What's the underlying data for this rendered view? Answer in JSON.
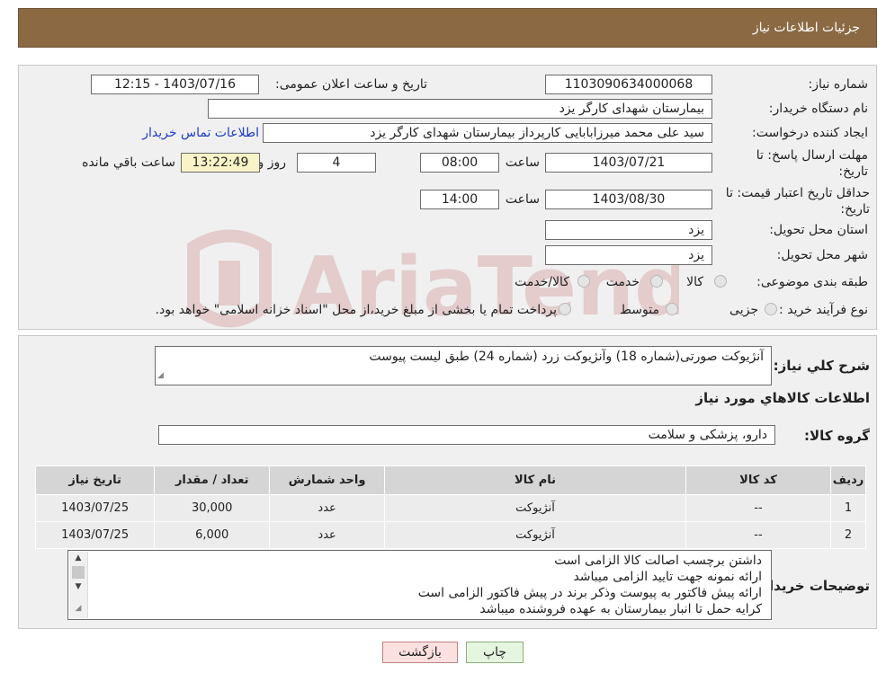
{
  "header": {
    "title": "جزئیات اطلاعات نیاز"
  },
  "form": {
    "need_number_label": "شماره نیاز:",
    "need_number": "1103090634000068",
    "announce_label": "تاریخ و ساعت اعلان عمومی:",
    "announce_value": "1403/07/16 - 12:15",
    "buyer_org_label": "نام دستگاه خریدار:",
    "buyer_org": "بیمارستان شهدای کارگر یزد",
    "creator_label": "ایجاد کننده درخواست:",
    "creator": "سید علی محمد میرزابابایی کارپرداز بیمارستان شهدای کارگر یزد",
    "contact_link": "اطلاعات تماس خریدار",
    "deadline_label": "مهلت ارسال پاسخ: تا تاریخ:",
    "deadline_date": "1403/07/21",
    "time_label": "ساعت",
    "deadline_time": "08:00",
    "days_value": "4",
    "days_label": "روز و",
    "remaining_time": "13:22:49",
    "remaining_label": "ساعت باقي مانده",
    "validity_label": "حداقل تاریخ اعتبار قیمت: تا تاریخ:",
    "validity_date": "1403/08/30",
    "validity_time": "14:00",
    "province_label": "استان محل تحویل:",
    "province": "یزد",
    "city_label": "شهر محل تحویل:",
    "city": "یزد",
    "category_label": "طبقه بندی موضوعی:",
    "category_options": [
      "کالا",
      "خدمت",
      "کالا/خدمت"
    ],
    "process_label": "نوع فرآیند خرید :",
    "process_options": [
      "جزیی",
      "متوسط"
    ],
    "process_note": "پرداخت تمام یا بخشی از مبلغ خرید،از محل \"اسناد خزانه اسلامی\" خواهد بود."
  },
  "details": {
    "summary_label": "شرح کلي نياز:",
    "summary": "آنژیوکت صورتی(شماره 18) وآنژیوکت زرد (شماره 24) طبق لیست پیوست",
    "goods_info_title": "اطلاعات کالاهاي مورد نياز",
    "group_label": "گروه کالا:",
    "group": "دارو، پزشکی و سلامت",
    "table": {
      "headers": [
        "ردیف",
        "کد کالا",
        "نام کالا",
        "واحد شمارش",
        "تعداد / مقدار",
        "تاریخ نیاز"
      ],
      "rows": [
        [
          "1",
          "--",
          "آنژیوکت",
          "عدد",
          "30,000",
          "1403/07/25"
        ],
        [
          "2",
          "--",
          "آنژیوکت",
          "عدد",
          "6,000",
          "1403/07/25"
        ]
      ]
    },
    "notes_label": "توضیحات خریدار:",
    "notes": [
      "داشتن برچسب اصالت کالا الزامی است",
      "ارائه نمونه جهت تایید الزامی میباشد",
      "ارائه پیش فاکتور به پیوست وذکر برند در پیش فاکتور الزامی است",
      "کرایه حمل تا انبار بیمارستان به عهده فروشنده میباشد"
    ]
  },
  "buttons": {
    "print": "چاپ",
    "back": "بازگشت"
  },
  "watermark": {
    "text": "AriaTender.neT"
  }
}
